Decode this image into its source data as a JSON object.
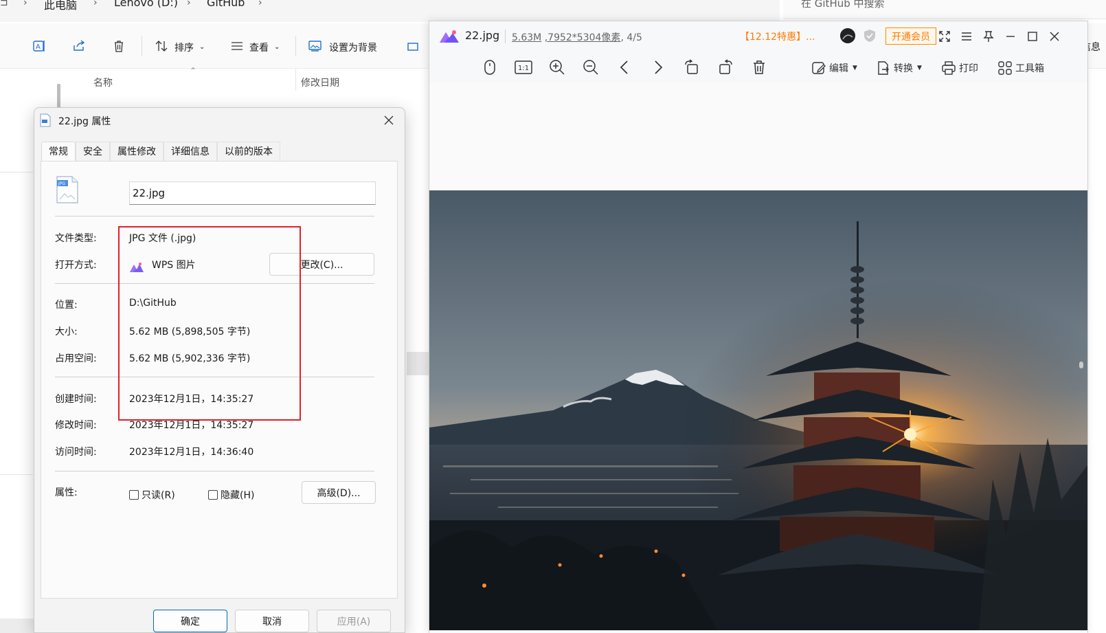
{
  "explorer": {
    "breadcrumb": [
      "此电脑",
      "Lenovo (D:)",
      "GitHub"
    ],
    "search_placeholder": "在 GitHub 中搜索",
    "toolbar": {
      "sort_label": "排序",
      "view_label": "查看",
      "set_background_label": "设置为背景",
      "details_label": "信息"
    },
    "columns": {
      "name": "名称",
      "modified": "修改日期"
    }
  },
  "dialog": {
    "title": "22.jpg 属性",
    "tabs": [
      "常规",
      "安全",
      "属性修改",
      "详细信息",
      "以前的版本"
    ],
    "active_tab": "常规",
    "filename_value": "22.jpg",
    "file_type_label": "文件类型:",
    "file_type_value": "JPG 文件 (.jpg)",
    "open_with_label": "打开方式:",
    "open_with_value": "WPS 图片",
    "change_button": "更改(C)...",
    "location_label": "位置:",
    "location_value": "D:\\GitHub",
    "size_label": "大小:",
    "size_value": "5.62 MB (5,898,505 字节)",
    "disk_size_label": "占用空间:",
    "disk_size_value": "5.62 MB (5,902,336 字节)",
    "created_label": "创建时间:",
    "created_value": "2023年12月1日，14:35:27",
    "modified_label": "修改时间:",
    "modified_value": "2023年12月1日，14:35:27",
    "accessed_label": "访问时间:",
    "accessed_value": "2023年12月1日，14:36:40",
    "attributes_label": "属性:",
    "readonly_label": "只读(R)",
    "hidden_label": "隐藏(H)",
    "advanced_button": "高级(D)...",
    "ok_button": "确定",
    "cancel_button": "取消",
    "apply_button": "应用(A)",
    "highlight_color": "#e0212b"
  },
  "viewer": {
    "filename": "22.jpg",
    "file_size": "5.63M",
    "dimensions": ",7952*5304像素",
    "position": ", 4/5",
    "promo": "【12.12特惠】...",
    "vip_button": "开通会员",
    "tools": {
      "edit": "编辑",
      "convert": "转换",
      "print": "打印",
      "toolbox": "工具箱"
    },
    "accent_color": "#ff7a00"
  }
}
